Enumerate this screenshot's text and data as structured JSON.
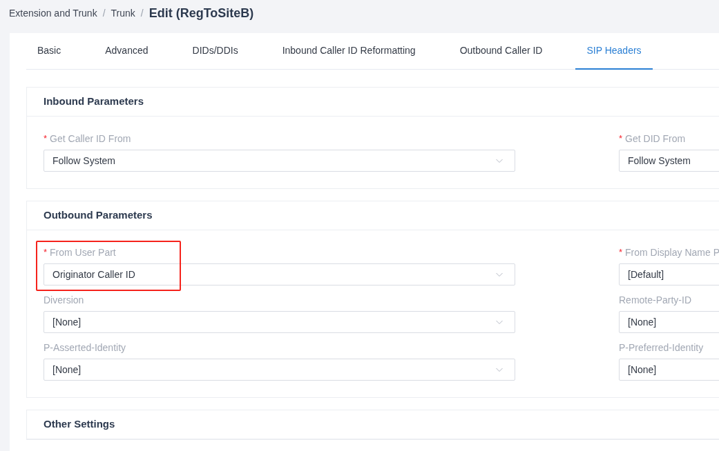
{
  "breadcrumb": [
    {
      "label": "Extension and Trunk",
      "current": false
    },
    {
      "label": "Trunk",
      "current": false
    },
    {
      "label": "Edit (RegToSiteB)",
      "current": true
    }
  ],
  "breadcrumb_separator": "/",
  "tabs": [
    {
      "label": "Basic",
      "selected": false
    },
    {
      "label": "Advanced",
      "selected": false
    },
    {
      "label": "DIDs/DDIs",
      "selected": false
    },
    {
      "label": "Inbound Caller ID Reformatting",
      "selected": false
    },
    {
      "label": "Outbound Caller ID",
      "selected": false
    },
    {
      "label": "SIP Headers",
      "selected": true
    }
  ],
  "sections": [
    {
      "title": "Inbound Parameters",
      "fields": [
        {
          "label": "Get Caller ID From",
          "required": true,
          "value": "Follow System",
          "highlighted": false
        },
        {
          "label": "Get DID From",
          "required": true,
          "value": "Follow System",
          "highlighted": false
        }
      ]
    },
    {
      "title": "Outbound Parameters",
      "fields": [
        {
          "label": "From User Part",
          "required": true,
          "value": "Originator Caller ID",
          "highlighted": true
        },
        {
          "label": "From Display Name P",
          "required": true,
          "value": "[Default]",
          "highlighted": false
        },
        {
          "label": "Diversion",
          "required": false,
          "value": "[None]",
          "highlighted": false
        },
        {
          "label": "Remote-Party-ID",
          "required": false,
          "value": "[None]",
          "highlighted": false
        },
        {
          "label": "P-Asserted-Identity",
          "required": false,
          "value": "[None]",
          "highlighted": false
        },
        {
          "label": "P-Preferred-Identity",
          "required": false,
          "value": "[None]",
          "highlighted": false
        }
      ]
    },
    {
      "title": "Other Settings"
    }
  ],
  "required_mark": "*"
}
